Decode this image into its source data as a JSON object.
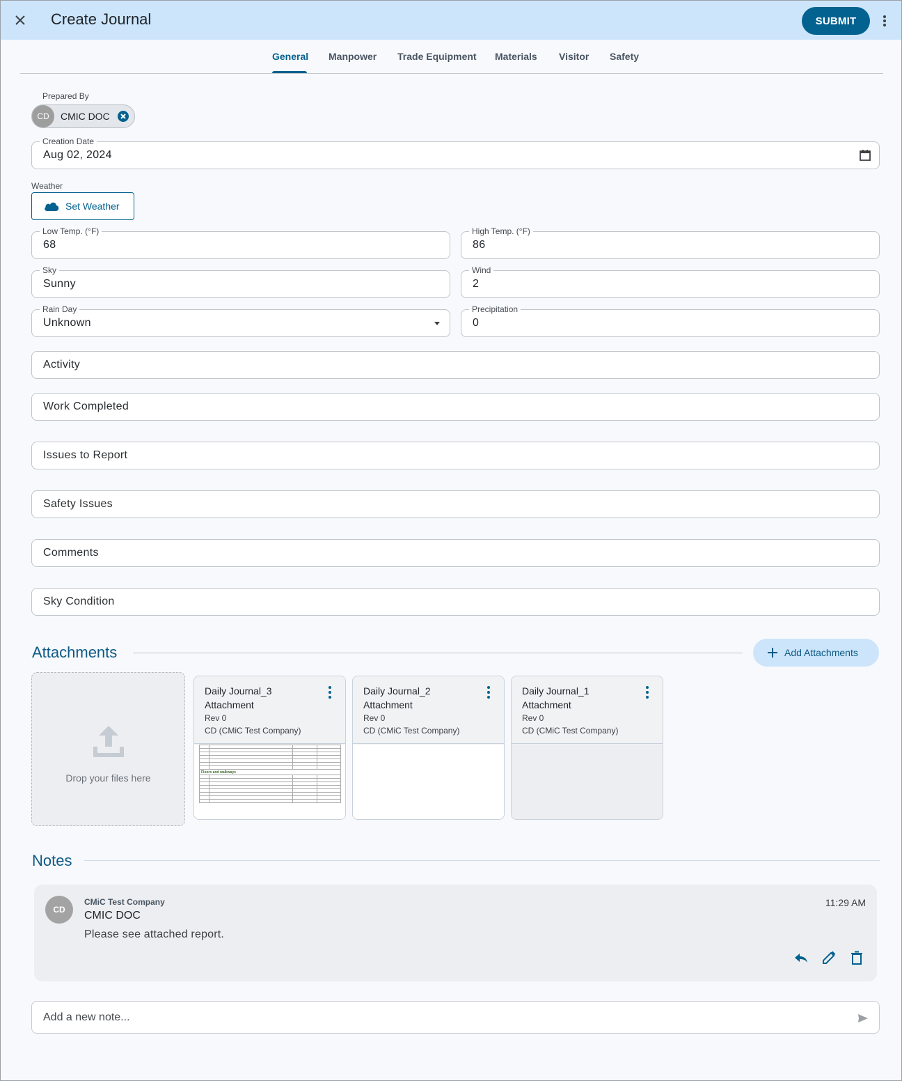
{
  "header": {
    "title": "Create Journal",
    "submit_label": "SUBMIT"
  },
  "tabs": [
    {
      "label": "General",
      "active": true
    },
    {
      "label": "Manpower",
      "active": false
    },
    {
      "label": "Trade Equipment",
      "active": false
    },
    {
      "label": "Materials",
      "active": false
    },
    {
      "label": "Visitor",
      "active": false
    },
    {
      "label": "Safety",
      "active": false
    }
  ],
  "general": {
    "prepared_by": {
      "label": "Prepared By",
      "initials": "CD",
      "name": "CMIC DOC"
    },
    "creation_date": {
      "label": "Creation Date",
      "value": "Aug 02, 2024"
    },
    "weather": {
      "label": "Weather",
      "button_label": "Set Weather"
    },
    "low_temp": {
      "label": "Low Temp. (°F)",
      "value": "68"
    },
    "high_temp": {
      "label": "High Temp. (°F)",
      "value": "86"
    },
    "sky": {
      "label": "Sky",
      "value": "Sunny"
    },
    "wind": {
      "label": "Wind",
      "value": "2"
    },
    "rain_day": {
      "label": "Rain Day",
      "value": "Unknown"
    },
    "precipitation": {
      "label": "Precipitation",
      "value": "0"
    },
    "text_fields": [
      {
        "placeholder": "Activity"
      },
      {
        "placeholder": "Work Completed"
      },
      {
        "placeholder": "Issues to Report"
      },
      {
        "placeholder": "Safety Issues"
      },
      {
        "placeholder": "Comments"
      },
      {
        "placeholder": "Sky Condition"
      }
    ]
  },
  "attachments": {
    "title": "Attachments",
    "add_label": "Add Attachments",
    "dropzone_text": "Drop your files here",
    "items": [
      {
        "title": "Daily Journal_3 Attachment",
        "rev": "Rev 0",
        "owner": "CD (CMiC Test Company)",
        "preview": "document"
      },
      {
        "title": "Daily Journal_2 Attachment",
        "rev": "Rev 0",
        "owner": "CD (CMiC Test Company)",
        "preview": "blank"
      },
      {
        "title": "Daily Journal_1 Attachment",
        "rev": "Rev 0",
        "owner": "CD (CMiC Test Company)",
        "preview": "empty"
      }
    ],
    "preview_doc": {
      "section_heading": "Floors and walkways"
    }
  },
  "notes": {
    "title": "Notes",
    "items": [
      {
        "initials": "CD",
        "company": "CMiC Test Company",
        "author": "CMIC DOC",
        "text": "Please see attached report.",
        "time": "11:29 AM"
      }
    ],
    "new_note_placeholder": "Add a new note..."
  },
  "colors": {
    "primary": "#03628f",
    "header_bg": "#cce5fb",
    "page_bg": "#f8f9fc"
  }
}
